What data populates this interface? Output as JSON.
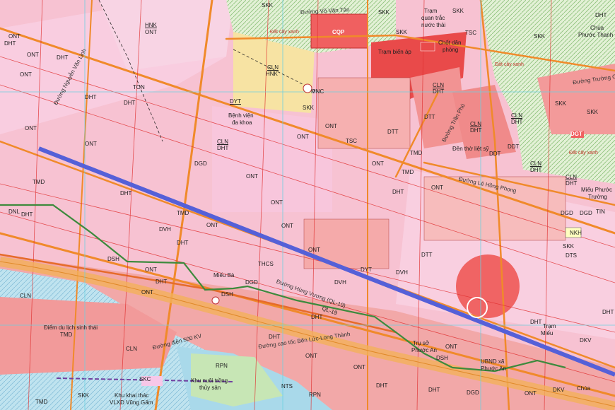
{
  "colors": {
    "residential": "#f6b8c8",
    "urban": "#f4a6a6",
    "block": "#f08080",
    "highlight": "#e94a4a",
    "green": "#d8ecc8",
    "water": "#a8d8ec",
    "yellow": "#f7e6a8",
    "road": "#f29b38",
    "grid": "#7fd4e0",
    "main_road": "#5560d8",
    "route": "#3d8a3d"
  },
  "labels": {
    "ONT": "ONT",
    "DHT": "DHT",
    "TMD": "TMD",
    "SKK": "SKK",
    "CLN": "CLN",
    "DGD": "DGD",
    "TSC": "TSC",
    "DYT": "DYT",
    "DVH": "DVH",
    "DTT": "DTT",
    "DSH": "DSH",
    "TON": "TON",
    "HNK": "HNK",
    "CQP": "CQP",
    "MNC": "MNC",
    "NKH": "NKH",
    "DGT": "DGT",
    "DTS": "DTS",
    "RPN": "RPN",
    "DKV": "DKV",
    "TIN": "TIN",
    "NTS": "NTS",
    "DNL": "DNL",
    "SKC": "SKC",
    "DDT": "DDT",
    "TSC2": "TSC",
    "THCS": "THCS"
  },
  "places": {
    "benh_vien_1": "Bệnh viện",
    "benh_vien_2": "đa khoa",
    "tram_bien_ap": "Trạm biến áp",
    "tram_quan_trac_1": "Trạm",
    "tram_quan_trac_2": "quan trắc",
    "tram_quan_trac_3": "nước thải",
    "chot_dan_phong_1": "Chốt dân",
    "chot_dan_phong_2": "phòng",
    "den_tho": "Đền thờ liệt sỹ",
    "chua_phuoc_thanh_1": "Chùa",
    "chua_phuoc_thanh_2": "Phước Thanh",
    "mieu_phuoc_truong_1": "Miếu Phước",
    "mieu_phuoc_truong_2": "Trường",
    "dat_cay_xanh_1": "Đất cây xanh",
    "dat_cay_xanh_2": "Đất cây xanh",
    "dat_cay_xanh_3": "Đất cây xanh",
    "mieu_ba": "Miếu Bà",
    "khu_du_lich_1": "Điểm du lịch sinh thái",
    "khu_nuoi_trong_1": "Khu nuôi trồng",
    "khu_nuoi_trong_2": "thủy sản",
    "khu_khai_thac_1": "Khu khai thác",
    "khu_khai_thac_2": "VLXD Vũng Gấm",
    "tru_so_1": "Trụ sở",
    "tru_so_2": "Phước An",
    "mieu": "Miếu",
    "chua": "Chùa",
    "tram_xe": "Trạm",
    "ubnd_1": "UBND xã",
    "ubnd_2": "Phước An"
  },
  "roads": {
    "vo_van_tan": "Đường Võ Văn Tân",
    "nguyen_van_linh": "Đường Nguyễn Văn Linh",
    "tran_phu": "Đường Trần Phú",
    "le_hong_phong": "Đường Lê Hồng Phong",
    "truong_chinh": "Đường Trường Chinh",
    "hung_vuong": "Đường Hùng Vương (QL-19)",
    "dien_500": "Đường điện 500 KV",
    "cao_toc": "Đường cao tốc Bến Lức-Long Thành",
    "ql19": "QL-19"
  }
}
